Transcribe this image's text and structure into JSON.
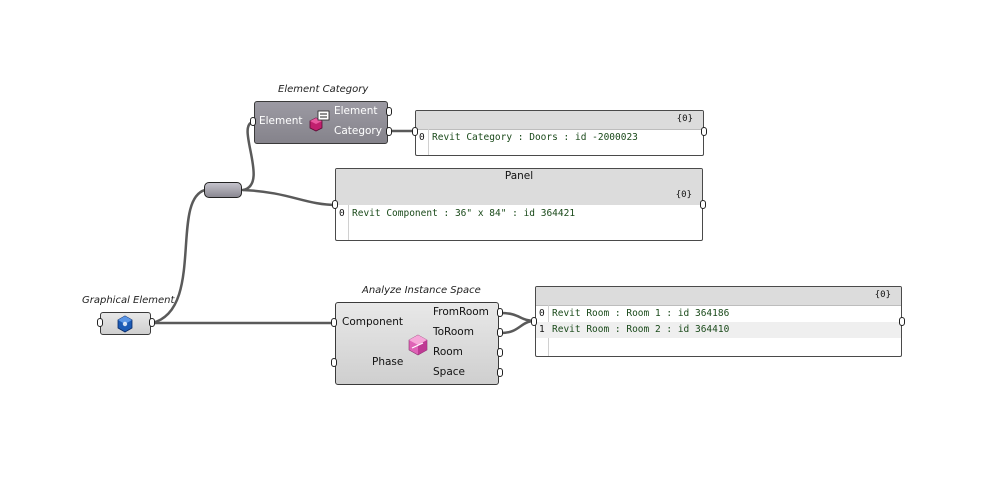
{
  "canvas": {
    "components": {
      "element_category": {
        "title": "Element Category",
        "inputs": [
          "Element"
        ],
        "outputs": [
          "Element",
          "Category"
        ],
        "icon": "element-category-icon"
      },
      "graphical_element": {
        "title": "Graphical Element",
        "icon": "graphical-element-icon"
      },
      "analyze_instance_space": {
        "title": "Analyze Instance Space",
        "inputs": [
          "Component",
          "Phase"
        ],
        "outputs": [
          "FromRoom",
          "ToRoom",
          "Room",
          "Space"
        ],
        "icon": "analyze-space-icon"
      }
    },
    "panels": {
      "category_panel": {
        "path": "{0}",
        "rows": [
          {
            "index": "0",
            "text": "Revit Category : Doors : id -2000023"
          }
        ]
      },
      "component_panel": {
        "caption": "Panel",
        "path": "{0}",
        "rows": [
          {
            "index": "0",
            "text": "Revit Component : 36\" x 84\" : id 364421"
          }
        ]
      },
      "room_panel": {
        "path": "{0}",
        "rows": [
          {
            "index": "0",
            "text": "Revit Room : Room 1 : id 364186"
          },
          {
            "index": "1",
            "text": "Revit Room : Room 2 : id 364410"
          }
        ]
      }
    },
    "colors": {
      "wire": "#5a5a5a",
      "dark_node": "#8f8d96",
      "light_node": "#dcdcdc"
    }
  }
}
